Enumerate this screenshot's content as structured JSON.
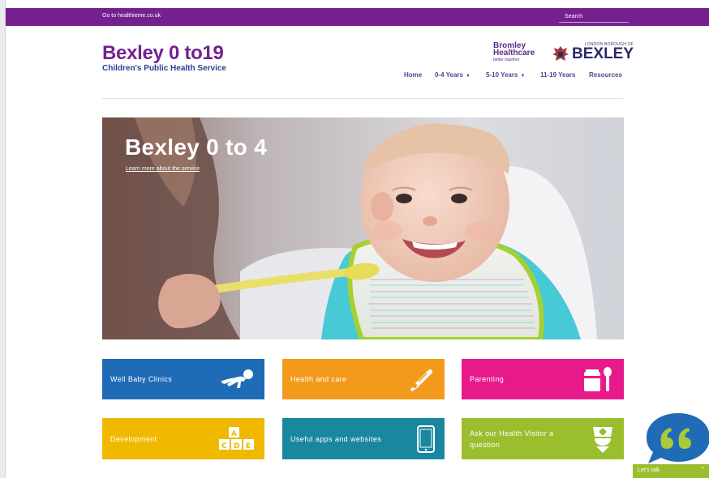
{
  "topbar": {
    "link": "Go to healthieme.co.uk",
    "search_placeholder": "Search",
    "bg_color": "#74218f"
  },
  "brand": {
    "title": "Bexley 0 to19",
    "subtitle": "Children's Public Health Service",
    "color": "#74218f"
  },
  "partner_logos": {
    "bromley": {
      "line1": "Bromley",
      "line2": "Healthcare",
      "tagline": "better together"
    },
    "bexley": {
      "small": "LONDON BOROUGH OF",
      "big": "BEXLEY",
      "icon": "crest-icon"
    }
  },
  "nav": {
    "items": [
      {
        "label": "Home"
      },
      {
        "label": "0-4 Years",
        "has_dropdown": true
      },
      {
        "label": "5-10 Years",
        "has_dropdown": true
      },
      {
        "label": "11-19 Years"
      },
      {
        "label": "Resources"
      }
    ]
  },
  "hero": {
    "headline": "Bexley 0 to 4",
    "link": "Learn more about the service"
  },
  "tiles": [
    {
      "label": "Well Baby Clinics",
      "color": "#1f6bb5",
      "icon": "crawling-baby-icon"
    },
    {
      "label": "Health and care",
      "color": "#f39a1c",
      "icon": "thermometer-icon"
    },
    {
      "label": "Parenting",
      "color": "#e8198b",
      "icon": "baby-food-jar-icon"
    },
    {
      "label": "Development",
      "color": "#f0b900",
      "icon": "building-blocks-icon"
    },
    {
      "label": "Useful apps and websites",
      "color": "#1a87a0",
      "icon": "mobile-phone-icon"
    },
    {
      "label": "Ask our Health Visitor a question",
      "color": "#9bbe2e",
      "icon": "nurse-icon"
    }
  ],
  "chat": {
    "label": "Let's talk",
    "bubble_icon": "quote-bubble-icon",
    "bubble_color": "#1f6bb5",
    "quote_color": "#a8c93a"
  }
}
